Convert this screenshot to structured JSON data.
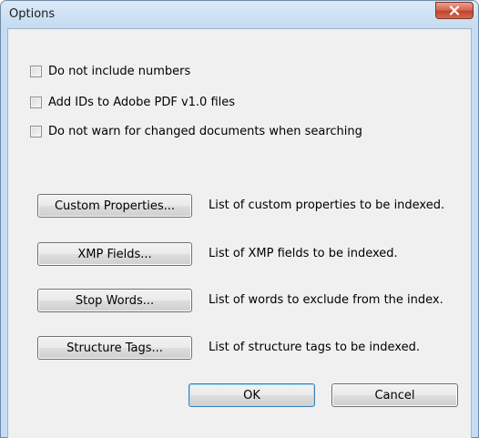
{
  "window": {
    "title": "Options",
    "close_label": "×"
  },
  "checkboxes": [
    {
      "label": "Do not include numbers",
      "checked": false
    },
    {
      "label": "Add IDs to Adobe PDF v1.0 files",
      "checked": false
    },
    {
      "label": "Do not warn for changed documents when searching",
      "checked": false
    }
  ],
  "index_buttons": [
    {
      "label": "Custom Properties...",
      "description": "List of custom properties to be indexed."
    },
    {
      "label": "XMP Fields...",
      "description": "List of XMP fields to be indexed."
    },
    {
      "label": "Stop Words...",
      "description": "List of words to exclude from the index."
    },
    {
      "label": "Structure Tags...",
      "description": "List of structure tags to be indexed."
    }
  ],
  "footer": {
    "ok_label": "OK",
    "cancel_label": "Cancel"
  },
  "colors": {
    "frame": "#c6dcf2",
    "client": "#f0f0f0",
    "close_button": "#c7432b"
  }
}
